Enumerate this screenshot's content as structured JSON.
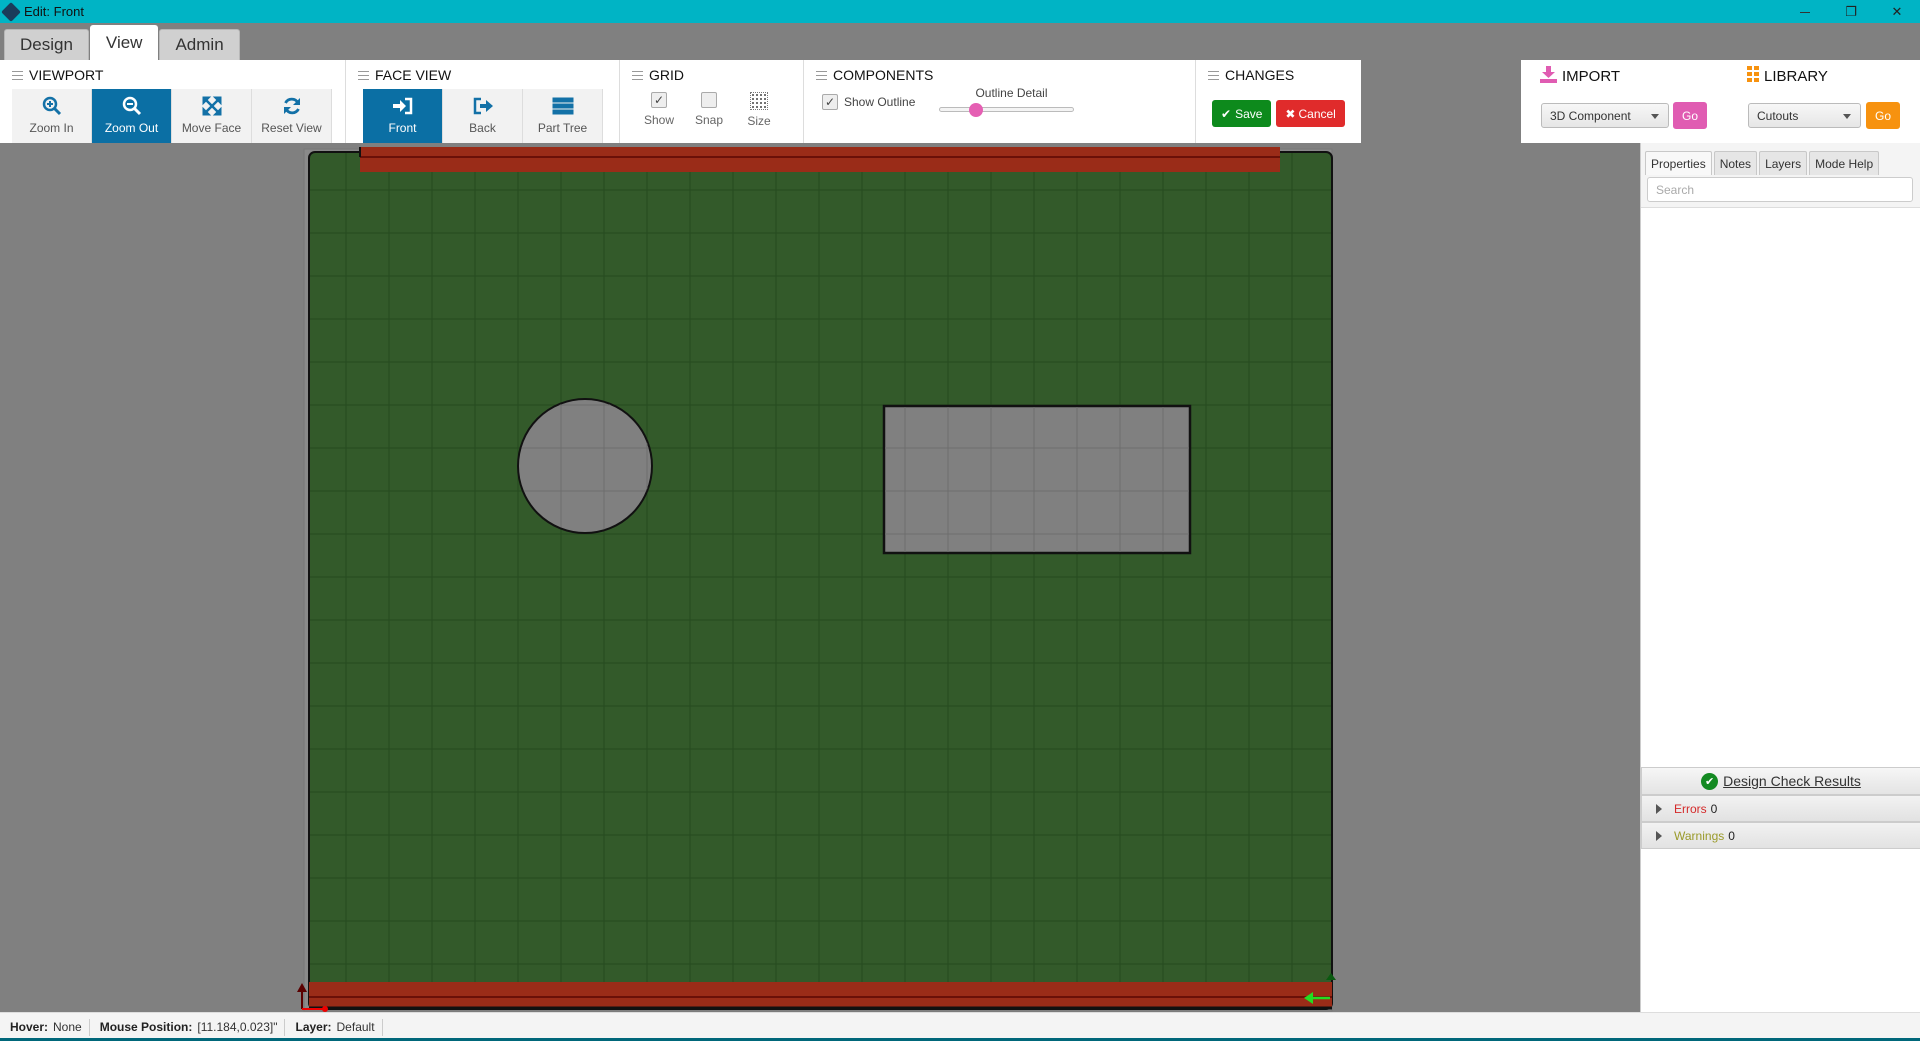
{
  "window": {
    "title": "Edit: Front",
    "controls": [
      "minimize",
      "restore",
      "close"
    ]
  },
  "tabs": [
    {
      "label": "Design",
      "active": false
    },
    {
      "label": "View",
      "active": true
    },
    {
      "label": "Admin",
      "active": false
    }
  ],
  "ribbon": {
    "viewport": {
      "title": "VIEWPORT",
      "buttons": [
        {
          "label": "Zoom In",
          "icon": "zoom-in-icon",
          "active": false
        },
        {
          "label": "Zoom Out",
          "icon": "zoom-out-icon",
          "active": true
        },
        {
          "label": "Move Face",
          "icon": "move-arrows-icon",
          "active": false
        },
        {
          "label": "Reset View",
          "icon": "refresh-icon",
          "active": false
        }
      ]
    },
    "face_view": {
      "title": "FACE VIEW",
      "buttons": [
        {
          "label": "Front",
          "icon": "sign-in-icon",
          "active": true
        },
        {
          "label": "Back",
          "icon": "sign-out-icon",
          "active": false
        },
        {
          "label": "Part Tree",
          "icon": "list-icon",
          "active": false
        }
      ]
    },
    "grid": {
      "title": "GRID",
      "show": {
        "label": "Show",
        "checked": true
      },
      "snap": {
        "label": "Snap",
        "checked": false
      },
      "size": {
        "label": "Size"
      }
    },
    "components": {
      "title": "COMPONENTS",
      "show_outline": {
        "label": "Show Outline",
        "checked": true
      },
      "outline_detail": {
        "label": "Outline Detail",
        "value_fraction": 0.27
      }
    },
    "changes": {
      "title": "CHANGES",
      "save_label": "Save",
      "cancel_label": "Cancel"
    }
  },
  "import": {
    "title": "IMPORT",
    "selected": "3D Component",
    "go_label": "Go",
    "color": "#e05cb2"
  },
  "library": {
    "title": "LIBRARY",
    "selected": "Cutouts",
    "go_label": "Go",
    "color": "#f7920f"
  },
  "canvas": {
    "board_color": "#335a2a",
    "edge_band_color": "#9a2c18",
    "cutout_color": "#808080",
    "cutouts": [
      {
        "type": "circle"
      },
      {
        "type": "rectangle"
      }
    ]
  },
  "right_panel": {
    "tabs": [
      {
        "label": "Properties",
        "active": true
      },
      {
        "label": "Notes",
        "active": false
      },
      {
        "label": "Layers",
        "active": false
      },
      {
        "label": "Mode Help",
        "active": false
      }
    ],
    "search_placeholder": "Search",
    "design_check": {
      "title": "Design Check Results",
      "errors_label": "Errors",
      "errors_count": "0",
      "warnings_label": "Warnings",
      "warnings_count": "0"
    }
  },
  "status": {
    "hover_label": "Hover:",
    "hover_value": "None",
    "mouse_label": "Mouse Position:",
    "mouse_value": "[11.184,0.023]\"",
    "layer_label": "Layer:",
    "layer_value": "Default"
  }
}
